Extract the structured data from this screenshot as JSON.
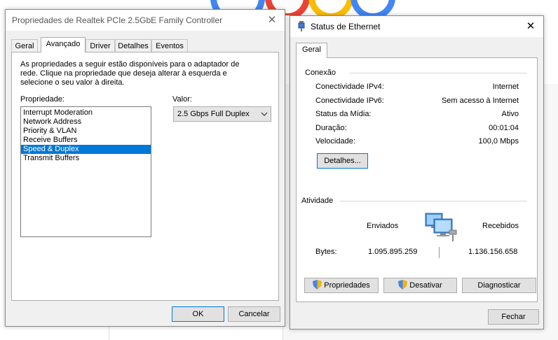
{
  "adapter_dialog": {
    "title": "Propriedades de Realtek PCIe 2.5GbE Family Controller",
    "tabs": [
      {
        "label": "Geral"
      },
      {
        "label": "Avançado"
      },
      {
        "label": "Driver"
      },
      {
        "label": "Detalhes"
      },
      {
        "label": "Eventos"
      }
    ],
    "description": "As propriedades a seguir estão disponíveis para o adaptador de rede. Clique na propriedade que deseja alterar à esquerda e selecione o seu valor à direita.",
    "property_label": "Propriedade:",
    "value_label": "Valor:",
    "properties": [
      {
        "label": "Interrupt Moderation"
      },
      {
        "label": "Network Address"
      },
      {
        "label": "Priority & VLAN"
      },
      {
        "label": "Receive Buffers"
      },
      {
        "label": "Speed & Duplex"
      },
      {
        "label": "Transmit Buffers"
      }
    ],
    "selected_value": "2.5 Gbps Full Duplex",
    "ok_label": "OK",
    "cancel_label": "Cancelar"
  },
  "status_dialog": {
    "title": "Status de Ethernet",
    "tab": "Geral",
    "connection_heading": "Conexão",
    "rows": [
      {
        "label": "Conectividade IPv4:",
        "value": "Internet"
      },
      {
        "label": "Conectividade IPv6:",
        "value": "Sem acesso à Internet"
      },
      {
        "label": "Status da Mídia:",
        "value": "Ativo"
      },
      {
        "label": "Duração:",
        "value": "00:01:04"
      },
      {
        "label": "Velocidade:",
        "value": "100,0 Mbps"
      }
    ],
    "details_label": "Detalhes...",
    "activity_heading": "Atividade",
    "sent_label": "Enviados",
    "received_label": "Recebidos",
    "bytes_label": "Bytes:",
    "bytes_sent": "1.095.895.259",
    "bytes_received": "1.136.156.658",
    "properties_btn": "Propriedades",
    "disable_btn": "Desativar",
    "diagnose_btn": "Diagnosticar",
    "close_btn": "Fechar"
  },
  "colors": {
    "selection": "#0078d7",
    "focus_border": "#0078d7",
    "google_blue": "#4285f4",
    "google_red": "#ea4335",
    "google_yellow": "#fbbc05"
  }
}
